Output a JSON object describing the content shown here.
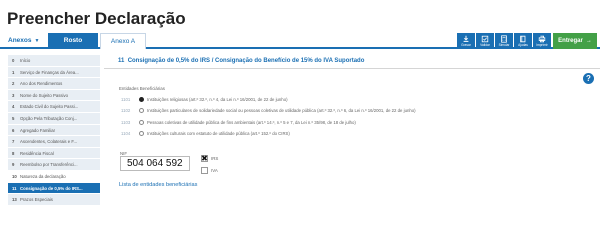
{
  "page": {
    "title": "Preencher Declaração"
  },
  "tabs": {
    "anexos": "Anexos",
    "rosto": "Rosto",
    "anexo_a": "Anexo A"
  },
  "toolbar": [
    {
      "label": "Gravar",
      "icon": "download-icon"
    },
    {
      "label": "Validar",
      "icon": "checklist-icon"
    },
    {
      "label": "Simular",
      "icon": "calculator-icon"
    },
    {
      "label": "Ajudas",
      "icon": "book-icon"
    },
    {
      "label": "Imprimir",
      "icon": "print-icon"
    }
  ],
  "submit": {
    "label": "Entregar",
    "icon": "arrow-right-icon"
  },
  "sidebar": [
    {
      "num": "0",
      "label": "Início"
    },
    {
      "num": "1",
      "label": "Serviço de Finanças da Área..."
    },
    {
      "num": "2",
      "label": "Ano dos Rendimentos"
    },
    {
      "num": "3",
      "label": "Nome do Sujeito Passivo"
    },
    {
      "num": "4",
      "label": "Estado Civil do Sujeito Passi..."
    },
    {
      "num": "5",
      "label": "Opção Pela Tributação Conj..."
    },
    {
      "num": "6",
      "label": "Agregado Familiar"
    },
    {
      "num": "7",
      "label": "Ascendentes, Colaterais e F..."
    },
    {
      "num": "8",
      "label": "Residência Fiscal"
    },
    {
      "num": "9",
      "label": "Reembolso por Transferênci..."
    },
    {
      "num": "10",
      "label": "Natureza da declaração"
    },
    {
      "num": "11",
      "label": "Consignação de 0,5% do IRS..."
    },
    {
      "num": "13",
      "label": "Prazos Especiais"
    }
  ],
  "section": {
    "number": "11",
    "title": "Consignação de 0,5% do IRS / Consignação do Benefício de 15% do IVA Suportado"
  },
  "help_label": "?",
  "entities": {
    "label": "Entidades Beneficiárias",
    "options": [
      {
        "code": "1101",
        "text": "Instituições religiosas (art.º 32.º, n.º 4, da Lei n.º 16/2001, de 22 de junho)",
        "selected": true
      },
      {
        "code": "1102",
        "text": "Instituições particulares de solidariedade social ou pessoas coletivas de utilidade pública (art.º 32.º, n.º 6, da Lei n.º 16/2001, de 22 de junho)",
        "selected": false
      },
      {
        "code": "1103",
        "text": "Pessoas coletivas de utilidade pública de fins ambientais (art.º 14.º, n.º 5 e 7, da Lei n.º 35/98, de 18 de julho)",
        "selected": false
      },
      {
        "code": "1104",
        "text": "Instituições culturais com estatuto de utilidade pública (art.º 152.º do CIRS)",
        "selected": false
      }
    ]
  },
  "nif": {
    "label": "NIF",
    "value": "504 064 592"
  },
  "checks": [
    {
      "label": "IRS",
      "checked": true
    },
    {
      "label": "IVA",
      "checked": false
    }
  ],
  "list_link": "Lista de entidades beneficiárias"
}
